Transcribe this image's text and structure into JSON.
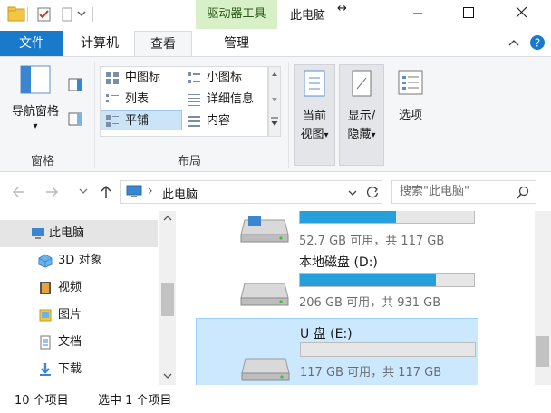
{
  "window": {
    "context_tab": "驱动器工具",
    "title": "此电脑",
    "resize_glyph": "↔"
  },
  "tabs": {
    "file": "文件",
    "computer": "计算机",
    "view": "查看",
    "manage": "管理"
  },
  "ribbon": {
    "nav_pane_label": "导航窗格",
    "group_panes": "窗格",
    "group_layout": "布局",
    "layout_items": {
      "medium_icons": "中图标",
      "small_icons": "小图标",
      "list": "列表",
      "details": "详细信息",
      "tiles": "平铺",
      "content": "内容"
    },
    "current_view_1": "当前",
    "current_view_2": "视图",
    "show_hide_1": "显示/",
    "show_hide_2": "隐藏",
    "options": "选项",
    "dropdown_glyph": "▾"
  },
  "address": {
    "chevron": "›",
    "path": "此电脑",
    "search_placeholder": "搜索\"此电脑\""
  },
  "nav_pane": {
    "items": [
      "此电脑",
      "3D 对象",
      "视频",
      "图片",
      "文档",
      "下载"
    ]
  },
  "drives": [
    {
      "name": "",
      "info": "52.7 GB 可用，共 117 GB",
      "used_fraction": 0.55
    },
    {
      "name": "本地磁盘 (D:)",
      "info": "206 GB 可用，共 931 GB",
      "used_fraction": 0.78
    },
    {
      "name": "U 盘 (E:)",
      "info": "117 GB 可用，共 117 GB",
      "used_fraction": 0.0
    }
  ],
  "status": {
    "item_count": "10 个项目",
    "selected": "选中 1 个项目"
  },
  "colors": {
    "accent": "#1979ca",
    "context_tab_bg": "#d7f0c8",
    "selection": "#cce8ff",
    "bar_fill": "#26a0da"
  }
}
